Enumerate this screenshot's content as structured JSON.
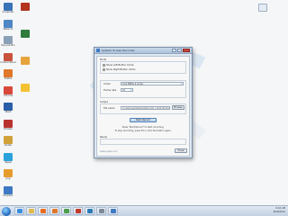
{
  "desktop": {
    "icons_left": [
      {
        "label": "Computer",
        "icon": "computer-icon",
        "color": "#3a73b8"
      },
      {
        "label": "Network",
        "icon": "network-icon",
        "color": "#4e86c6"
      },
      {
        "label": "Recycle Bin",
        "icon": "recycle-bin-icon",
        "color": "#8aa0b8"
      },
      {
        "label": "Control Panel",
        "icon": "control-panel-icon",
        "color": "#c9523d"
      },
      {
        "label": "Firefox",
        "icon": "firefox-icon",
        "color": "#e0772a"
      },
      {
        "label": "Chrome",
        "icon": "chrome-icon",
        "color": "#d8483a"
      },
      {
        "label": "Word",
        "icon": "word-icon",
        "color": "#2b5fa8"
      },
      {
        "label": "McAfee",
        "icon": "app-icon",
        "color": "#b8332f"
      },
      {
        "label": "Kodak",
        "icon": "app-icon",
        "color": "#d1a23a"
      },
      {
        "label": "Skype",
        "icon": "skype-icon",
        "color": "#2aa2dc"
      },
      {
        "label": "Jing",
        "icon": "app-icon",
        "color": "#e69b2d"
      },
      {
        "label": "Dropbox",
        "icon": "dropbox-icon",
        "color": "#3d79c4"
      }
    ],
    "icons_col2": [
      {
        "label": "",
        "icon": "app-icon",
        "color": "#b3341f"
      },
      {
        "label": "",
        "icon": "app-icon",
        "color": "#2f7b3c"
      },
      {
        "label": "",
        "icon": "app-icon",
        "color": "#e6a33c"
      },
      {
        "label": "",
        "icon": "app-icon",
        "color": "#f2c230"
      }
    ],
    "icon_right": {
      "label": "",
      "icon": "document-icon",
      "color": "#d9e3ef"
    }
  },
  "dialog": {
    "title": "System Screen Recorder",
    "mode_section": "Mode",
    "mode_options": [
      {
        "label": "Show Left Button Clicks",
        "selected": true
      },
      {
        "label": "Show Right Button Clicks",
        "selected": false
      }
    ],
    "codec_label": "Codec",
    "codec_value": "Xvid MPEG-4 Codec",
    "frame_rate_label": "Frame rate",
    "frame_rate_value": "15",
    "output_section": "Output",
    "file_name_label": "File name",
    "file_name_value": "C:\\Users\\user\\Desktop\\Recorder 1 2014-08-20.avi",
    "browse_button": "Browse",
    "start_button": "Start Record",
    "note_line1": "Press \"Start Record\" to start recording.",
    "note_line2": "To stop recording, press F9 or click the button again.",
    "status_label": "Ready",
    "website": "www.xydee.com",
    "close_button": "Close"
  },
  "taskbar": {
    "time": "6:16 AM",
    "date": "8/20/2014",
    "items": [
      {
        "icon": "ie-icon",
        "color": "#3a8ee0"
      },
      {
        "icon": "explorer-icon",
        "color": "#e1b94a"
      },
      {
        "icon": "media-player-icon",
        "color": "#e86d20"
      },
      {
        "icon": "firefox-icon",
        "color": "#e0772a"
      },
      {
        "icon": "chrome-icon",
        "color": "#4c9e4a"
      },
      {
        "icon": "app-icon",
        "color": "#c0392b"
      },
      {
        "icon": "app-icon",
        "color": "#2c7bb6"
      },
      {
        "icon": "app-icon",
        "color": "#7d8a97"
      },
      {
        "icon": "recorder-icon",
        "color": "#3f7ac2"
      }
    ]
  }
}
